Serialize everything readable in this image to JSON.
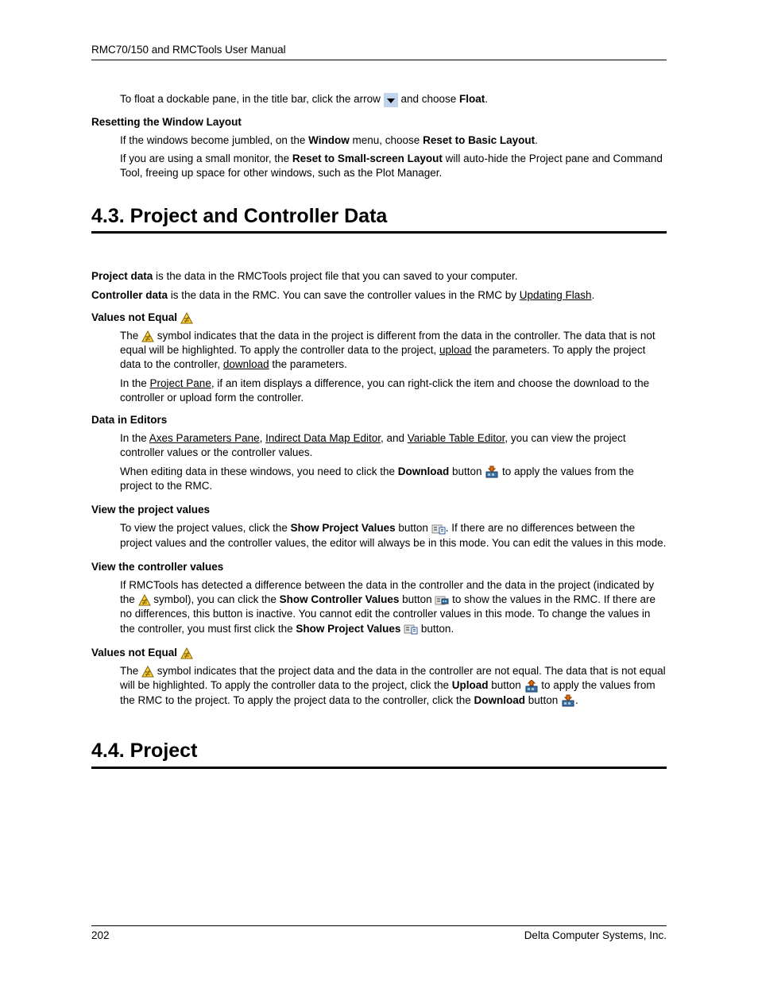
{
  "header": {
    "title": "RMC70/150 and RMCTools User Manual"
  },
  "intro": {
    "float_pre": "To float a dockable pane, in the title bar, click the arrow ",
    "float_post": " and choose ",
    "float_bold": "Float",
    "float_end": "."
  },
  "reset": {
    "heading": "Resetting the Window Layout",
    "line1_pre": "If the windows become jumbled, on the ",
    "line1_b1": "Window",
    "line1_mid": " menu, choose ",
    "line1_b2": "Reset to Basic Layout",
    "line1_end": ".",
    "line2_pre": "If you are using a small monitor, the ",
    "line2_b": "Reset to Small-screen Layout",
    "line2_post": " will auto-hide the Project pane and Command Tool, freeing up space for other windows, such as the Plot Manager."
  },
  "s43": {
    "title": "4.3. Project and Controller Data",
    "p1_b": "Project data",
    "p1_t": " is the data in the RMCTools project file that you can saved to your computer.",
    "p2_b": "Controller data",
    "p2_t1": " is the data in the RMC. You can save the controller values in the RMC by ",
    "p2_link": "Updating Flash",
    "p2_t2": ".",
    "vne_heading": "Values not Equal ",
    "vne_p1_pre": "The ",
    "vne_p1_post": " symbol indicates that the data in the project is different from the data in the controller. The data that is not equal will be highlighted. To apply the controller data to the project, ",
    "vne_p1_link1": "upload",
    "vne_p1_mid": " the parameters. To apply the project data to the controller, ",
    "vne_p1_link2": "download",
    "vne_p1_end": " the parameters.",
    "vne_p2_pre": "In the ",
    "vne_p2_link": "Project Pane",
    "vne_p2_post": ", if an item displays a difference, you can right-click the item and choose the download to the controller or upload form the controller.",
    "die_heading": "Data in Editors",
    "die_p1_pre": "In the ",
    "die_p1_l1": "Axes Parameters Pane",
    "die_p1_c1": ", ",
    "die_p1_l2": "Indirect Data Map Editor",
    "die_p1_c2": ", and ",
    "die_p1_l3": "Variable Table Editor",
    "die_p1_end": ", you can view the project controller values or the controller values.",
    "die_p2_pre": "When editing data in these windows, you need to click the ",
    "die_p2_b": "Download",
    "die_p2_mid": " button ",
    "die_p2_end": " to apply the values from the project to the RMC.",
    "vpv_h": "View the project values",
    "vpv_p_pre": "To view the project values, click the ",
    "vpv_p_b": "Show Project Values",
    "vpv_p_mid": " button ",
    "vpv_p_end": ".  If there are no differences between the project values and the controller values, the editor will always be in this mode. You can edit the values in this mode.",
    "vcv_h": "View the controller values",
    "vcv_p_pre": "If RMCTools has detected a difference between the data in the controller and the data in the project (indicated by the ",
    "vcv_p_mid1": " symbol), you can click the ",
    "vcv_p_b1": "Show Controller Values",
    "vcv_p_mid2": " button ",
    "vcv_p_mid3": " to show the values in the RMC. If there are no differences, this button is inactive. You cannot edit the controller values in this mode. To change the values in the controller, you must first click the ",
    "vcv_p_b2": "Show Project Values",
    "vcv_p_end": " button.",
    "vne2_h": "Values not Equal ",
    "vne2_p_pre": "The ",
    "vne2_p_mid1": " symbol indicates that the project data and the data in the controller are not equal. The data that is not equal will be highlighted. To apply the controller data to the project, click the ",
    "vne2_p_b1": "Upload",
    "vne2_p_mid2": " button ",
    "vne2_p_mid3": "  to apply the values from the RMC to the project. To apply the project data to the controller, click the ",
    "vne2_p_b2": "Download",
    "vne2_p_mid4": " button ",
    "vne2_p_end": "."
  },
  "s44": {
    "title": "4.4. Project"
  },
  "footer": {
    "page": "202",
    "company": "Delta Computer Systems, Inc."
  }
}
